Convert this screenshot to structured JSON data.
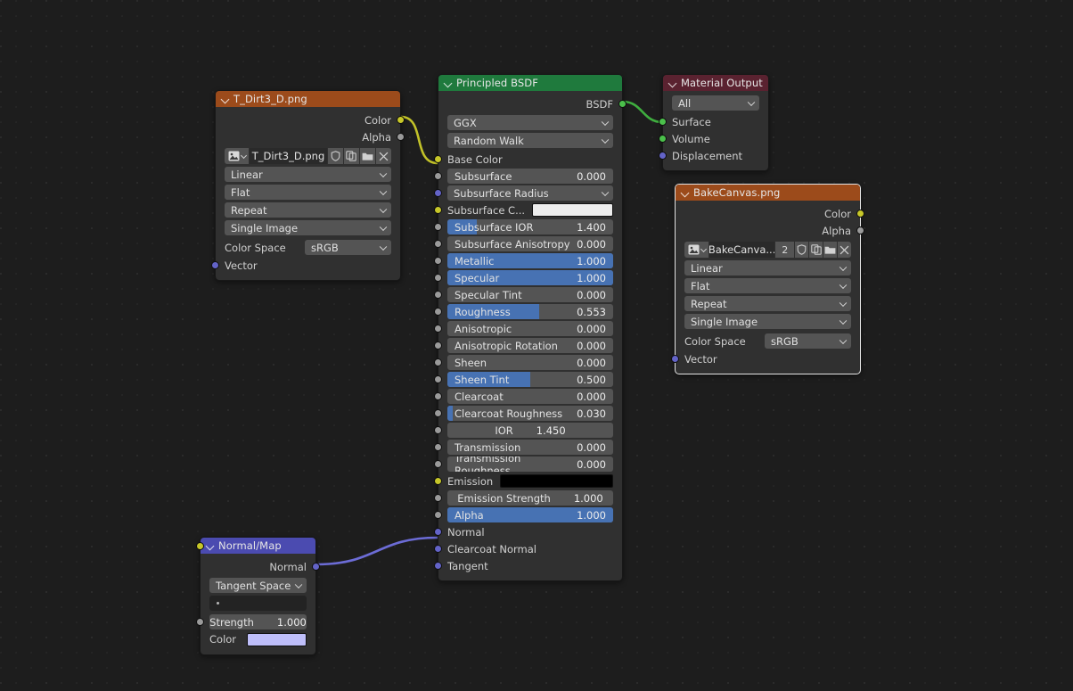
{
  "app": {
    "editor": "Shader Node Editor",
    "background_color": "#1d1d1d"
  },
  "colors": {
    "texture_header": "#9c4b1b",
    "shader_header": "#1f7a3d",
    "output_header": "#5a2230",
    "vector_header": "#4b4bb0",
    "slider_fill": "#4772b3",
    "link_color_yellow": "#c2c229",
    "link_color_green": "#3fae3f",
    "link_color_purple": "#6c6cd6"
  },
  "nodes": {
    "image_texture_dirt": {
      "title": "T_Dirt3_D.png",
      "outputs": [
        {
          "label": "Color",
          "socket": "yellow-socket"
        },
        {
          "label": "Alpha",
          "socket": "grey-socket"
        }
      ],
      "datablock": {
        "browse_icon": "image-browse-icon",
        "name": "T_Dirt3_D.png",
        "users": "",
        "icons": [
          "shield-icon",
          "duplicate-icon",
          "folder-open-icon",
          "unlink-x-icon"
        ]
      },
      "interpolation": "Linear",
      "projection": "Flat",
      "extension": "Repeat",
      "source": "Single Image",
      "color_space_label": "Color Space",
      "color_space": "sRGB",
      "inputs": [
        {
          "label": "Vector",
          "socket": "purple-socket"
        }
      ]
    },
    "principled_bsdf": {
      "title": "Principled BSDF",
      "outputs": [
        {
          "label": "BSDF",
          "socket": "green-socket"
        }
      ],
      "distribution": "GGX",
      "subsurface_method": "Random Walk",
      "inputs": [
        {
          "label": "Base Color",
          "type": "socket_only",
          "socket": "yellow-socket"
        },
        {
          "label": "Subsurface",
          "type": "slider",
          "value": "0.000",
          "fill_pct": 0,
          "socket": "grey-socket"
        },
        {
          "label": "Subsurface Radius",
          "type": "dropdown",
          "socket": "purple-socket"
        },
        {
          "label": "Subsurface C...",
          "type": "color",
          "value": "#ececec",
          "socket": "yellow-socket"
        },
        {
          "label": "Subsurface IOR",
          "type": "slider",
          "value": "1.400",
          "fill_pct": 18,
          "socket": "grey-socket"
        },
        {
          "label": "Subsurface Anisotropy",
          "type": "slider",
          "value": "0.000",
          "fill_pct": 0,
          "socket": "grey-socket"
        },
        {
          "label": "Metallic",
          "type": "slider",
          "value": "1.000",
          "fill_pct": 100,
          "socket": "grey-socket"
        },
        {
          "label": "Specular",
          "type": "slider",
          "value": "1.000",
          "fill_pct": 100,
          "socket": "grey-socket"
        },
        {
          "label": "Specular Tint",
          "type": "slider",
          "value": "0.000",
          "fill_pct": 0,
          "socket": "grey-socket"
        },
        {
          "label": "Roughness",
          "type": "slider",
          "value": "0.553",
          "fill_pct": 55.3,
          "socket": "grey-socket"
        },
        {
          "label": "Anisotropic",
          "type": "slider",
          "value": "0.000",
          "fill_pct": 0,
          "socket": "grey-socket"
        },
        {
          "label": "Anisotropic Rotation",
          "type": "slider",
          "value": "0.000",
          "fill_pct": 0,
          "socket": "grey-socket"
        },
        {
          "label": "Sheen",
          "type": "slider",
          "value": "0.000",
          "fill_pct": 0,
          "socket": "grey-socket"
        },
        {
          "label": "Sheen Tint",
          "type": "slider",
          "value": "0.500",
          "fill_pct": 50,
          "socket": "grey-socket"
        },
        {
          "label": "Clearcoat",
          "type": "slider",
          "value": "0.000",
          "fill_pct": 0,
          "socket": "grey-socket"
        },
        {
          "label": "Clearcoat Roughness",
          "type": "slider",
          "value": "0.030",
          "fill_pct": 3,
          "socket": "grey-socket"
        },
        {
          "label": "IOR",
          "type": "slider_centered",
          "value": "1.450",
          "fill_pct": 0,
          "socket": "grey-socket"
        },
        {
          "label": "Transmission",
          "type": "slider",
          "value": "0.000",
          "fill_pct": 0,
          "socket": "grey-socket"
        },
        {
          "label": "Transmission Roughness",
          "type": "slider",
          "value": "0.000",
          "fill_pct": 0,
          "socket": "grey-socket"
        },
        {
          "label": "Emission",
          "type": "color",
          "value": "#000000",
          "socket": "yellow-socket"
        },
        {
          "label": "Emission Strength",
          "type": "slider_centered",
          "value": "1.000",
          "fill_pct": 0,
          "socket": "grey-socket"
        },
        {
          "label": "Alpha",
          "type": "slider",
          "value": "1.000",
          "fill_pct": 100,
          "socket": "grey-socket"
        },
        {
          "label": "Normal",
          "type": "socket_only",
          "socket": "purple-socket"
        },
        {
          "label": "Clearcoat Normal",
          "type": "socket_only",
          "socket": "purple-socket"
        },
        {
          "label": "Tangent",
          "type": "socket_only",
          "socket": "purple-socket"
        }
      ]
    },
    "material_output": {
      "title": "Material Output",
      "target": "All",
      "inputs": [
        {
          "label": "Surface",
          "socket": "green-socket"
        },
        {
          "label": "Volume",
          "socket": "green-socket"
        },
        {
          "label": "Displacement",
          "socket": "purple-socket"
        }
      ]
    },
    "image_texture_bake": {
      "title": "BakeCanvas.png",
      "selected": true,
      "outputs": [
        {
          "label": "Color",
          "socket": "yellow-socket"
        },
        {
          "label": "Alpha",
          "socket": "grey-socket"
        }
      ],
      "datablock": {
        "browse_icon": "image-browse-icon",
        "name": "BakeCanva...",
        "users": "2",
        "icons": [
          "shield-icon",
          "duplicate-icon",
          "folder-open-icon",
          "unlink-x-icon"
        ]
      },
      "interpolation": "Linear",
      "projection": "Flat",
      "extension": "Repeat",
      "source": "Single Image",
      "color_space_label": "Color Space",
      "color_space": "sRGB",
      "inputs": [
        {
          "label": "Vector",
          "socket": "purple-socket"
        }
      ]
    },
    "normal_map": {
      "title": "Normal/Map",
      "outputs": [
        {
          "label": "Normal",
          "socket": "purple-socket"
        }
      ],
      "space": "Tangent Space",
      "uv_map": "",
      "strength_label": "Strength",
      "strength_value": "1.000",
      "color_label": "Color",
      "color_value": "#bfbffa"
    }
  }
}
